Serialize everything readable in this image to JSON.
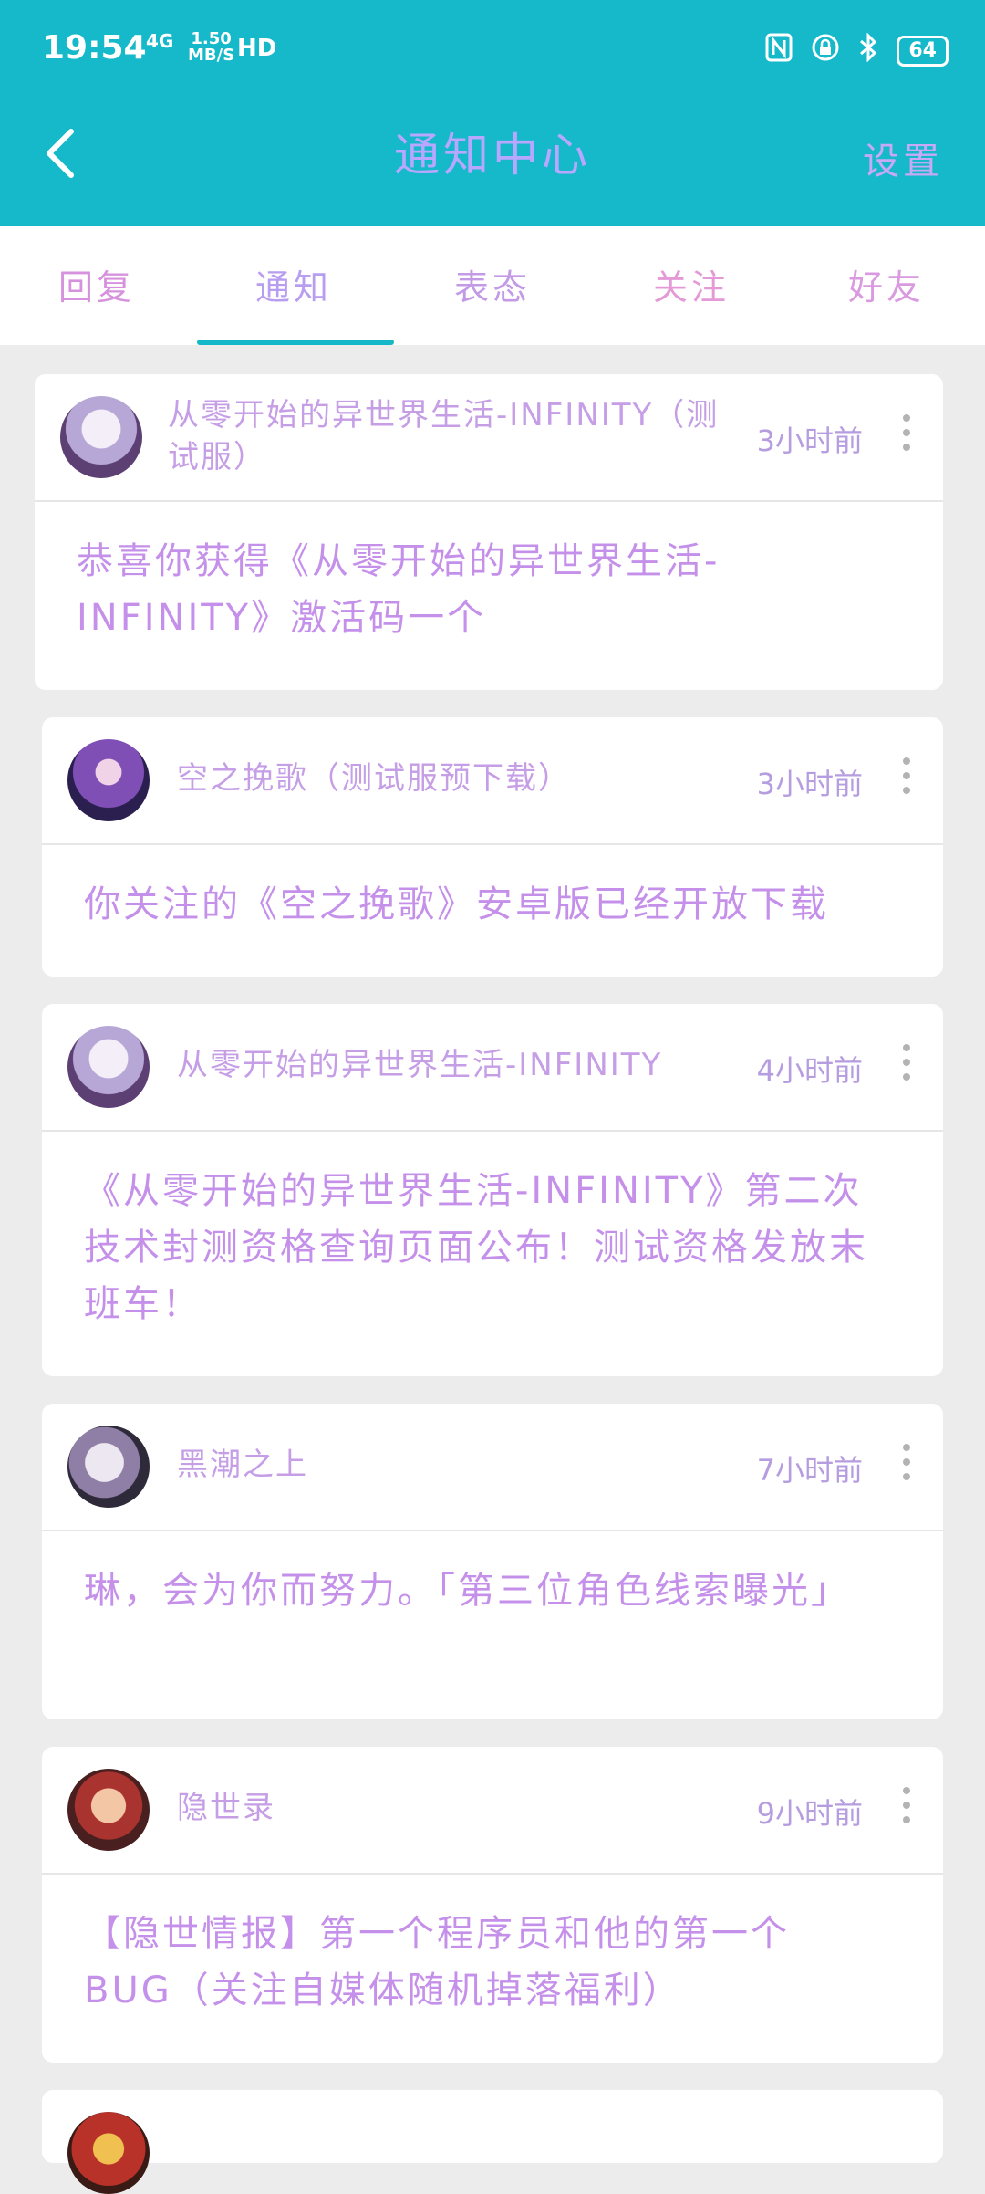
{
  "status_bar": {
    "time": "19:54",
    "network": "4G",
    "speed_value": "1.50",
    "speed_unit": "MB/S",
    "hd": "HD",
    "battery": "64"
  },
  "header": {
    "title": "通知中心",
    "settings_label": "设置"
  },
  "tabs": [
    {
      "label": "回复"
    },
    {
      "label": "通知"
    },
    {
      "label": "表态"
    },
    {
      "label": "关注"
    },
    {
      "label": "好友"
    }
  ],
  "active_tab": "通知",
  "notifications": [
    {
      "source": "从零开始的异世界生活-INFINITY（测试服）",
      "time": "3小时前",
      "message": "恭喜你获得《从零开始的异世界生活-INFINITY》激活码一个"
    },
    {
      "source": "空之挽歌（测试服预下载）",
      "time": "3小时前",
      "message": "你关注的《空之挽歌》安卓版已经开放下载"
    },
    {
      "source": "从零开始的异世界生活-INFINITY",
      "time": "4小时前",
      "message": "《从零开始的异世界生活-INFINITY》第二次技术封测资格查询页面公布！测试资格发放末班车！"
    },
    {
      "source": "黑潮之上",
      "time": "7小时前",
      "message": "琳，会为你而努力。「第三位角色线索曝光」"
    },
    {
      "source": "隐世录",
      "time": "9小时前",
      "message": "【隐世情报】第一个程序员和他的第一个BUG（关注自媒体随机掉落福利）"
    }
  ],
  "colors": {
    "header_bg": "#15b9c9",
    "tab_underline": "#14b8c8",
    "page_bg": "#ececec"
  }
}
